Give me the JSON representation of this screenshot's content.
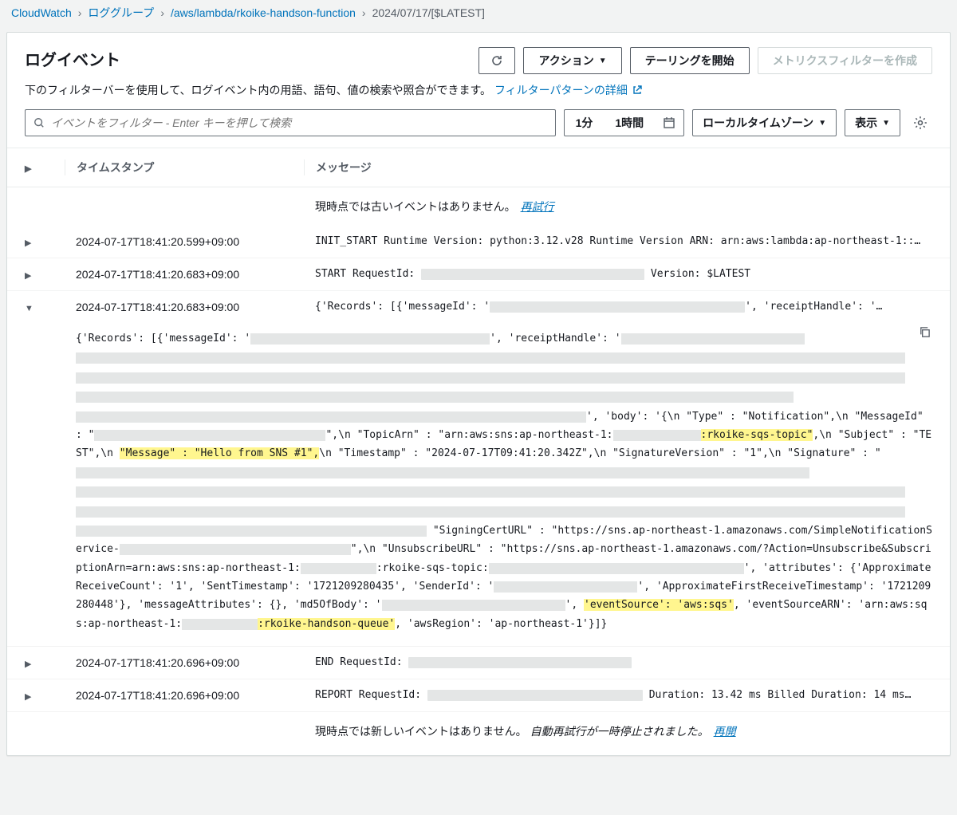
{
  "breadcrumb": {
    "items": [
      "CloudWatch",
      "ロググループ",
      "/aws/lambda/rkoike-handson-function"
    ],
    "current": "2024/07/17/[$LATEST]"
  },
  "header": {
    "title": "ログイベント",
    "refresh": "↻",
    "actions": "アクション",
    "tailing": "テーリングを開始",
    "metric_filter": "メトリクスフィルターを作成"
  },
  "subhead": {
    "text": "下のフィルターバーを使用して、ログイベント内の用語、語句、値の検索や照合ができます。",
    "link": "フィルターパターンの詳細"
  },
  "toolbar": {
    "search_placeholder": "イベントをフィルター - Enter キーを押して検索",
    "time1": "1分",
    "time2": "1時間",
    "timezone": "ローカルタイムゾーン",
    "display": "表示"
  },
  "table": {
    "col_ts": "タイムスタンプ",
    "col_msg": "メッセージ",
    "no_old": "現時点では古いイベントはありません。",
    "retry": "再試行",
    "no_new": "現時点では新しいイベントはありません。",
    "paused": "自動再試行が一時停止されました。",
    "resume": "再開"
  },
  "rows": [
    {
      "ts": "2024-07-17T18:41:20.599+09:00",
      "msg_pre": "INIT_START Runtime Version: python:3.12.v28 Runtime Version ARN: arn:aws:lambda:ap-northeast-1::…"
    },
    {
      "ts": "2024-07-17T18:41:20.683+09:00",
      "msg_pre": "START RequestId: ",
      "msg_post": " Version: $LATEST"
    },
    {
      "ts": "2024-07-17T18:41:20.683+09:00",
      "msg_pre": "{'Records': [{'messageId': '",
      "msg_mid": "', 'receiptHandle': '",
      "expanded": true
    },
    {
      "ts": "2024-07-17T18:41:20.696+09:00",
      "msg_pre": "END RequestId: "
    },
    {
      "ts": "2024-07-17T18:41:20.696+09:00",
      "msg_pre": "REPORT RequestId: ",
      "msg_post": " Duration: 13.42 ms Billed Duration: 14 ms…"
    }
  ],
  "expanded": {
    "p1_pre": "{'Records': [{'messageId': '",
    "p1_mid": "', 'receiptHandle': '",
    "body_intro": "', 'body': '{\\n  \"Type\" : \"Notification\",\\n  \"MessageId\" : \"",
    "topic_pre": "\",\\n  \"TopicArn\" : \"arn:aws:sns:ap-northeast-1:",
    "topic_hl": ":rkoike-sqs-topic\"",
    "subject": ",\\n  \"Subject\" : \"TEST\",\\n  ",
    "message_hl": "\"Message\" : \"Hello from SNS #1\",",
    "timestamp": "\\n  \"Timestamp\" : \"2024-07-17T09:41:20.342Z\",\\n  \"SignatureVersion\" : \"1\",\\n  \"Signature\" : \"",
    "signcert_pre": "  \"SigningCertURL\" : \"https://sns.ap-northeast-1.amazonaws.com/SimpleNotificationService-",
    "unsub": "\",\\n  \"UnsubscribeURL\" : \"https://sns.ap-northeast-1.amazonaws.com/?Action=Unsubscribe&SubscriptionArn=arn:aws:sns:ap-northeast-1:",
    "unsub_post": ":rkoike-sqs-topic:",
    "attrs": "', 'attributes': {'ApproximateReceiveCount': '1', 'SentTimestamp': '1721209280435', 'SenderId': '",
    "attrs2": "', 'ApproximateFirstReceiveTimestamp': '1721209280448'}, 'messageAttributes': {}, 'md5OfBody': '",
    "attrs3_close": "', ",
    "eventsource_hl": "'eventSource': 'aws:sqs'",
    "arn_pre": ", 'eventSourceARN': 'arn:aws:sqs:ap-northeast-1:",
    "arn_hl": ":rkoike-handson-queue'",
    "region": ", 'awsRegion': 'ap-northeast-1'}]}"
  }
}
